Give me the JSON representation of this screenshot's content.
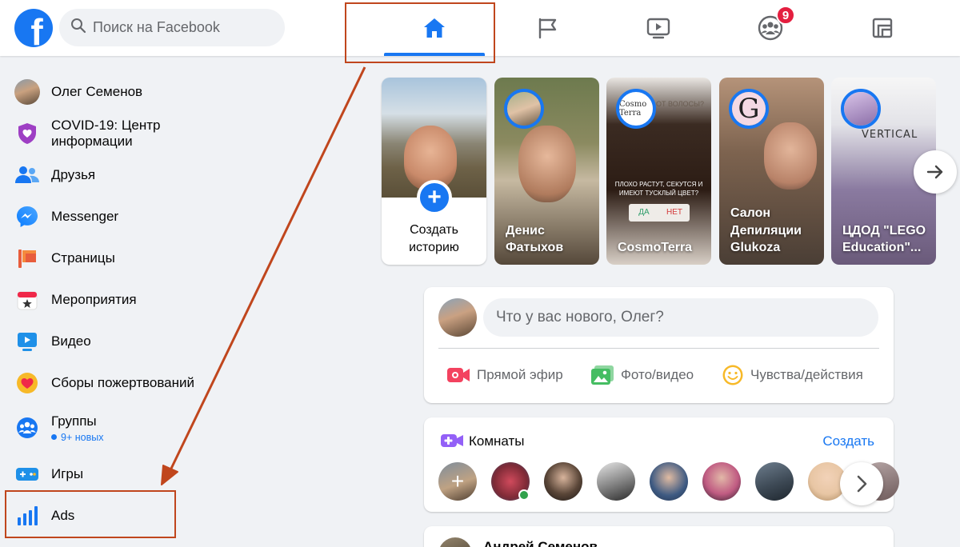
{
  "search": {
    "placeholder": "Поиск на Facebook"
  },
  "nav": {
    "groups_badge": "9"
  },
  "colors": {
    "brand": "#1877f2",
    "annotation": "#c0461d",
    "badge": "#e41e3f"
  },
  "sidebar": {
    "items": [
      {
        "label": "Олег Семенов",
        "icon": "user-avatar"
      },
      {
        "label": "COVID-19: Центр информации",
        "icon": "covid-shield-icon"
      },
      {
        "label": "Друзья",
        "icon": "friends-icon"
      },
      {
        "label": "Messenger",
        "icon": "messenger-icon"
      },
      {
        "label": "Страницы",
        "icon": "pages-flag-icon"
      },
      {
        "label": "Мероприятия",
        "icon": "events-calendar-icon"
      },
      {
        "label": "Видео",
        "icon": "video-play-icon"
      },
      {
        "label": "Сборы пожертвований",
        "icon": "fundraiser-heart-icon"
      },
      {
        "label": "Группы",
        "icon": "groups-icon",
        "sub": "9+ новых"
      },
      {
        "label": "Игры",
        "icon": "gamepad-icon"
      },
      {
        "label": "Ads",
        "icon": "ads-bar-chart-icon"
      }
    ]
  },
  "stories": {
    "create_label": "Создать историю",
    "items": [
      {
        "name": "Денис Фатыхов"
      },
      {
        "name": "CosmoTerra"
      },
      {
        "name": "Салон Депиляции Glukoza"
      },
      {
        "name": "ЦДОД \"LEGO Education\"..."
      }
    ],
    "story_2_overlay": {
      "top_text": "ОТ ВОЛОСЫ?",
      "mid_text": "ПЛОХО РАСТУТ, СЕКУТСЯ И ИМЕЮТ ТУСКЛЫЙ ЦВЕТ?",
      "yes": "ДА",
      "no": "НЕТ",
      "brand": "Cosmo Terra"
    },
    "story_4_overlay": {
      "brand": "VERTICAL"
    }
  },
  "composer": {
    "placeholder": "Что у вас нового, Олег?",
    "actions": [
      {
        "label": "Прямой эфир",
        "icon": "live-video-icon",
        "color": "#f3425f"
      },
      {
        "label": "Фото/видео",
        "icon": "photo-icon",
        "color": "#45bd62"
      },
      {
        "label": "Чувства/действия",
        "icon": "feeling-smile-icon",
        "color": "#f7b928"
      }
    ]
  },
  "rooms": {
    "title": "Комнаты",
    "create_label": "Создать"
  },
  "post": {
    "author": "Андрей Семенов"
  }
}
